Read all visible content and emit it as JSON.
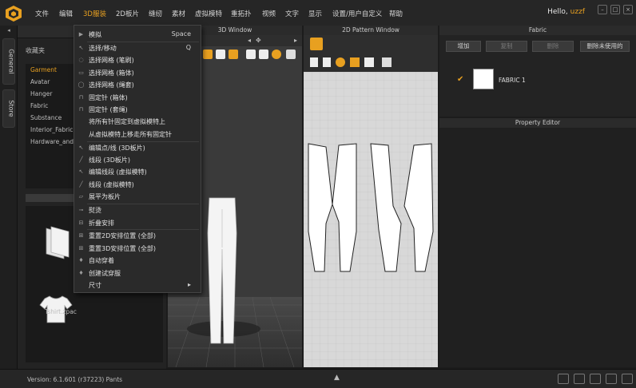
{
  "app": {
    "menus": [
      "文件",
      "编辑",
      "3D服装",
      "2D板片",
      "缝纫",
      "素材",
      "虚拟模特",
      "重拓扑",
      "视频",
      "文字",
      "显示",
      "设置/用户自定义",
      "帮助"
    ],
    "active_menu_index": 2,
    "greeting": "Hello, ",
    "username": "uzzf",
    "accent_color": "#e8a020"
  },
  "left_tabs": [
    "General",
    "Store"
  ],
  "library": {
    "folder_title": "收藏夹",
    "tree": [
      "Garment",
      "Avatar",
      "Hanger",
      "Fabric",
      "Substance",
      "Interior_Fabric",
      "Hardware_and_..."
    ],
    "selected_index": 0,
    "files": [
      {
        "name": "",
        "icon": "folder-icon"
      },
      {
        "name": "Tshirt.zpac",
        "icon": "tshirt-icon"
      }
    ]
  },
  "window3d": {
    "title": "3D Window"
  },
  "window2d": {
    "title": "2D Pattern Window"
  },
  "fabric_panel": {
    "title": "Fabric",
    "buttons": [
      "增加",
      "复制",
      "删除",
      "删除未使用的"
    ],
    "items": [
      {
        "name": "FABRIC 1",
        "checked": true
      }
    ]
  },
  "property_panel": {
    "title": "Property Editor"
  },
  "status": {
    "text": "Version:    6.1.601 (r37223)   Pants"
  },
  "dropdown": {
    "items": [
      {
        "label": "模拟",
        "shortcut": "Space",
        "icon": "simulate-icon"
      },
      {
        "label": "选择/移动",
        "shortcut": "Q",
        "icon": "select-move-icon"
      },
      {
        "label": "选择网格 (笔刷)",
        "shortcut": "",
        "icon": "mesh-brush-icon"
      },
      {
        "label": "选择网格 (箱体)",
        "shortcut": "",
        "icon": "mesh-box-icon"
      },
      {
        "label": "选择网格 (绳套)",
        "shortcut": "",
        "icon": "mesh-lasso-icon"
      },
      {
        "label": "固定针 (箱体)",
        "shortcut": "",
        "icon": "pin-box-icon"
      },
      {
        "label": "固定针 (套绳)",
        "shortcut": "",
        "icon": "pin-lasso-icon"
      },
      {
        "label": "将所有针固定到虚拟模特上",
        "shortcut": "",
        "icon": ""
      },
      {
        "label": "从虚拟模特上移走所有固定针",
        "shortcut": "",
        "icon": ""
      },
      {
        "label": "编辑点/线 (3D板片)",
        "shortcut": "",
        "icon": "edit-point-icon"
      },
      {
        "label": "线段 (3D板片)",
        "shortcut": "",
        "icon": "segment-icon"
      },
      {
        "label": "编辑线段 (虚拟模特)",
        "shortcut": "",
        "icon": "edit-segment-icon"
      },
      {
        "label": "线段 (虚拟模特)",
        "shortcut": "",
        "icon": "segment-avatar-icon"
      },
      {
        "label": "展平为板片",
        "shortcut": "",
        "icon": "flatten-icon"
      },
      {
        "label": "熨烫",
        "shortcut": "",
        "icon": "iron-icon"
      },
      {
        "label": "折叠安排",
        "shortcut": "",
        "icon": "fold-icon"
      },
      {
        "label": "重置2D安排位置 (全部)",
        "shortcut": "",
        "icon": "reset-2d-icon"
      },
      {
        "label": "重置3D安排位置 (全部)",
        "shortcut": "",
        "icon": "reset-3d-icon"
      },
      {
        "label": "自动穿着",
        "shortcut": "",
        "icon": "auto-dress-icon"
      },
      {
        "label": "创建试穿服",
        "shortcut": "",
        "icon": "fitting-icon"
      },
      {
        "label": "尺寸",
        "shortcut": "",
        "icon": "",
        "submenu": true
      }
    ]
  }
}
